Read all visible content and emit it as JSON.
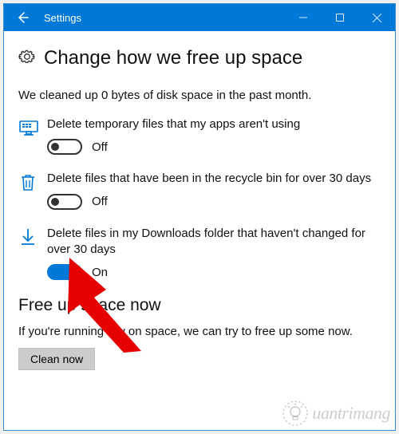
{
  "titlebar": {
    "title": "Settings"
  },
  "page": {
    "heading": "Change how we free up space",
    "status": "We cleaned up 0 bytes of disk space in the past month."
  },
  "settings": {
    "temp": {
      "label": "Delete temporary files that my apps aren't using",
      "state_text": "Off"
    },
    "recycle": {
      "label": "Delete files that have been in the recycle bin for over 30 days",
      "state_text": "Off"
    },
    "downloads": {
      "label": "Delete files in my Downloads folder that haven't changed for over 30 days",
      "state_text": "On"
    }
  },
  "free_up": {
    "heading": "Free up space now",
    "desc": "If you're running low on space, we can try to free up some now.",
    "button": "Clean now"
  },
  "watermark": {
    "text": "uantrimang"
  }
}
